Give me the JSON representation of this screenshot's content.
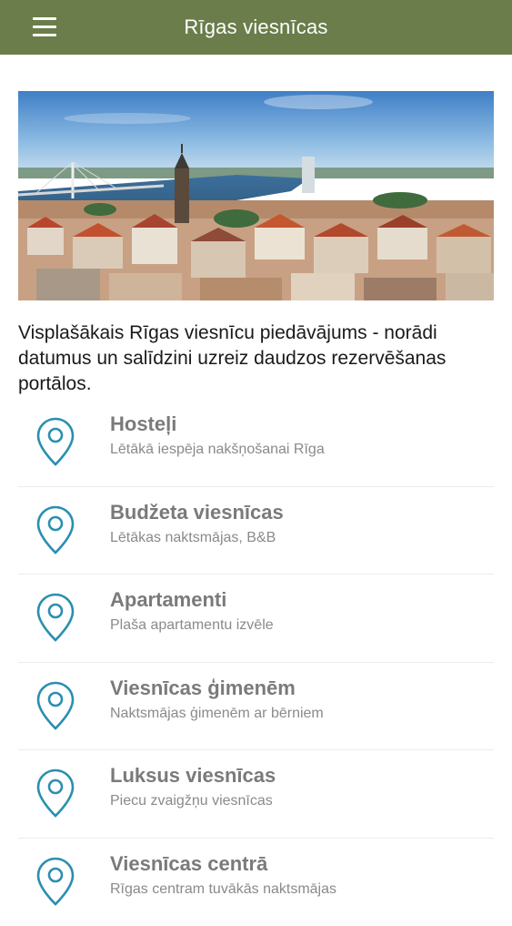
{
  "header": {
    "title": "Rīgas viesnīcas",
    "menu_icon": "hamburger-menu-icon",
    "background_color": "#6a7d4a"
  },
  "hero": {
    "description": "Riga cityscape photo with cable-stayed bridge, river and red rooftops"
  },
  "intro_text": "Visplašākais Rīgas viesnīcu piedāvājums - norādi datumus un salīdzini uzreiz daudzos rezervēšanas portālos.",
  "accent_color": "#2a8fb0",
  "categories": [
    {
      "title": "Hosteļi",
      "subtitle": "Lētākā iespēja nakšņošanai Rīga",
      "icon": "location-pin-icon"
    },
    {
      "title": "Budžeta viesnīcas",
      "subtitle": "Lētākas naktsmājas, B&B",
      "icon": "location-pin-icon"
    },
    {
      "title": "Apartamenti",
      "subtitle": "Plaša apartamentu izvēle",
      "icon": "location-pin-icon"
    },
    {
      "title": "Viesnīcas ģimenēm",
      "subtitle": "Naktsmājas ģimenēm ar bērniem",
      "icon": "location-pin-icon"
    },
    {
      "title": "Luksus viesnīcas",
      "subtitle": "Piecu zvaigžņu viesnīcas",
      "icon": "location-pin-icon"
    },
    {
      "title": "Viesnīcas centrā",
      "subtitle": "Rīgas centram tuvākās naktsmājas",
      "icon": "location-pin-icon"
    }
  ]
}
